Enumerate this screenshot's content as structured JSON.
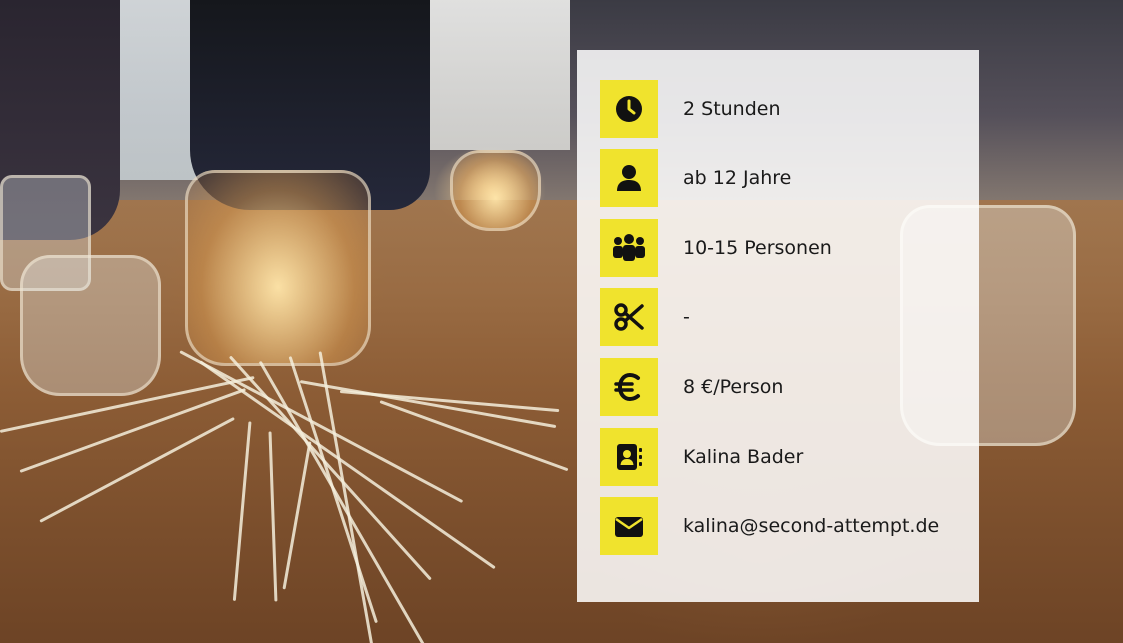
{
  "background": {
    "icon": "photo-macrame-jars"
  },
  "accent_color": "#f0e32d",
  "info": {
    "items": [
      {
        "icon": "clock-icon",
        "text": "2 Stunden"
      },
      {
        "icon": "user-icon",
        "text": "ab 12 Jahre"
      },
      {
        "icon": "users-icon",
        "text": "10-15 Personen"
      },
      {
        "icon": "scissors-icon",
        "text": "-"
      },
      {
        "icon": "euro-icon",
        "text": "8 €/Person"
      },
      {
        "icon": "contact-card-icon",
        "text": "Kalina Bader"
      },
      {
        "icon": "envelope-icon",
        "text": "kalina@second-attempt.de"
      }
    ]
  }
}
